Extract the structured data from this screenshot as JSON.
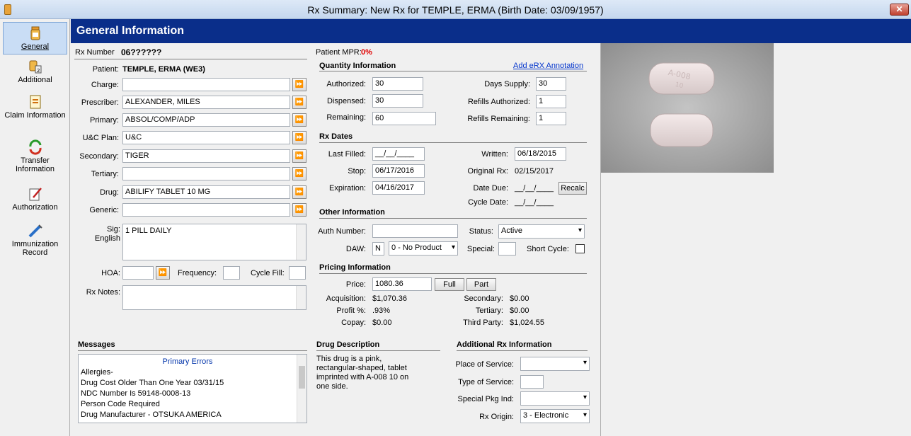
{
  "window": {
    "title": "Rx Summary: New Rx for TEMPLE, ERMA (Birth Date: 03/09/1957)",
    "close_glyph": "✕"
  },
  "sidebar": {
    "items": [
      {
        "label": "General",
        "icon": "pill-bottle-icon"
      },
      {
        "label": "Additional",
        "icon": "bottles-icon"
      },
      {
        "label": "Claim Information",
        "icon": "claim-document-icon"
      },
      {
        "label": "Transfer Information",
        "icon": "transfer-arrows-icon"
      },
      {
        "label": "Authorization",
        "icon": "authorization-pen-icon"
      },
      {
        "label": "Immunization Record",
        "icon": "syringe-icon"
      }
    ]
  },
  "header": {
    "title": "General Information"
  },
  "rx": {
    "number_label": "Rx Number",
    "number": "06??????",
    "mpr_label": "Patient MPR:",
    "mpr_value": "0%"
  },
  "patient": {
    "patient_label": "Patient:",
    "patient_value": "TEMPLE, ERMA (WE3)",
    "charge_label": "Charge:",
    "charge_value": "",
    "prescriber_label": "Prescriber:",
    "prescriber_value": "ALEXANDER, MILES",
    "primary_label": "Primary:",
    "primary_value": "ABSOL/COMP/ADP",
    "ucplan_label": "U&C Plan:",
    "ucplan_value": "U&C",
    "secondary_label": "Secondary:",
    "secondary_value": "TIGER",
    "tertiary_label": "Tertiary:",
    "tertiary_value": "",
    "drug_label": "Drug:",
    "drug_value": "ABILIFY TABLET 10 MG",
    "generic_label": "Generic:",
    "generic_value": "",
    "sig_label": "Sig:",
    "sig_lang": "English",
    "sig_value": "1 PILL DAILY",
    "hoa_label": "HOA:",
    "frequency_label": "Frequency:",
    "cyclefill_label": "Cycle Fill:",
    "rxnotes_label": "Rx Notes:",
    "ff_glyph": "⏩"
  },
  "quantity": {
    "section": "Quantity Information",
    "annotation_link": "Add eRX Annotation",
    "authorized_label": "Authorized:",
    "authorized": "30",
    "dispensed_label": "Dispensed:",
    "dispensed": "30",
    "remaining_label": "Remaining:",
    "remaining": "60",
    "days_supply_label": "Days Supply:",
    "days_supply": "30",
    "refills_auth_label": "Refills Authorized:",
    "refills_auth": "1",
    "refills_rem_label": "Refills Remaining:",
    "refills_rem": "1"
  },
  "dates": {
    "section": "Rx Dates",
    "last_filled_label": "Last Filled:",
    "last_filled": "__/__/____",
    "stop_label": "Stop:",
    "stop": "06/17/2016",
    "expiration_label": "Expiration:",
    "expiration": "04/16/2017",
    "written_label": "Written:",
    "written": "06/18/2015",
    "original_label": "Original Rx:",
    "original": "02/15/2017",
    "due_label": "Date Due:",
    "due": "__/__/____",
    "recalc": "Recalc",
    "cycle_label": "Cycle Date:",
    "cycle": "__/__/____"
  },
  "other": {
    "section": "Other Information",
    "auth_label": "Auth Number:",
    "auth": "",
    "daw_label": "DAW:",
    "daw_code": "N",
    "daw_select": "0 - No Product",
    "status_label": "Status:",
    "status": "Active",
    "special_label": "Special:",
    "shortcycle_label": "Short Cycle:"
  },
  "pricing": {
    "section": "Pricing Information",
    "price_label": "Price:",
    "price": "1080.36",
    "full": "Full",
    "part": "Part",
    "acq_label": "Acquisition:",
    "acq": "$1,070.36",
    "profit_label": "Profit %:",
    "profit": ".93%",
    "copay_label": "Copay:",
    "copay": "$0.00",
    "sec_label": "Secondary:",
    "sec": "$0.00",
    "ter_label": "Tertiary:",
    "ter": "$0.00",
    "third_label": "Third Party:",
    "third": "$1,024.55"
  },
  "messages": {
    "section": "Messages",
    "header": "Primary Errors",
    "lines": [
      "Allergies-",
      "Drug Cost Older Than One Year 03/31/15",
      "NDC Number Is 59148-0008-13",
      "Person Code Required",
      "Drug Manufacturer - OTSUKA AMERICA"
    ]
  },
  "drug_desc": {
    "section": "Drug Description",
    "text": "This drug is a pink, rectangular-shaped, tablet imprinted with A-008  10 on one side."
  },
  "additional": {
    "section": "Additional Rx Information",
    "place_label": "Place of Service:",
    "type_label": "Type of Service:",
    "pkg_label": "Special Pkg Ind:",
    "origin_label": "Rx Origin:",
    "origin": "3 - Electronic"
  },
  "pill": {
    "imprint_top": "A-008",
    "imprint_bottom": "10"
  },
  "colors": {
    "header_bg": "#0a2e8a",
    "mpr": "#e00000",
    "link": "#0033cc"
  }
}
